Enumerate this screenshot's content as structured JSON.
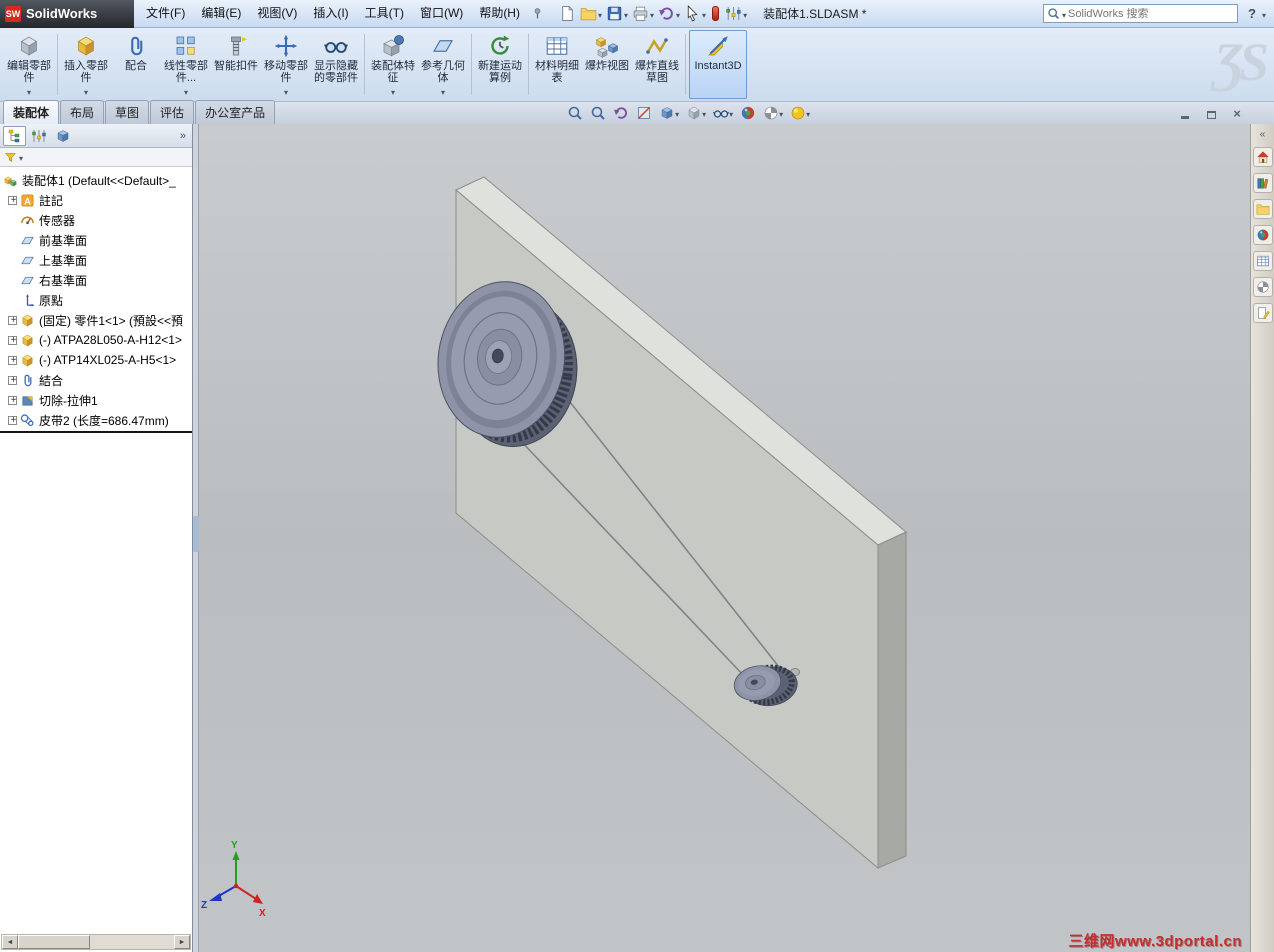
{
  "app": {
    "name": "SolidWorks",
    "logo_badge": "SW",
    "doc_title": "装配体1.SLDASM *",
    "ghost_logo": "ƷS"
  },
  "titlebar": {
    "help": "?"
  },
  "menubar": {
    "items": [
      "文件(F)",
      "编辑(E)",
      "视图(V)",
      "插入(I)",
      "工具(T)",
      "窗口(W)",
      "帮助(H)"
    ]
  },
  "search": {
    "placeholder": "SolidWorks 搜索"
  },
  "commandbar": {
    "buttons": [
      {
        "label": "编辑零部件",
        "dropdown": true
      },
      {
        "label": "插入零部件",
        "dropdown": true
      },
      {
        "label": "配合",
        "dropdown": false
      },
      {
        "label": "线性零部件...",
        "dropdown": true
      },
      {
        "label": "智能扣件",
        "dropdown": false
      },
      {
        "label": "移动零部件",
        "dropdown": true
      },
      {
        "label": "显示隐藏的零部件",
        "dropdown": false
      },
      {
        "label": "装配体特征",
        "dropdown": true
      },
      {
        "label": "参考几何体",
        "dropdown": true
      },
      {
        "label": "新建运动算例",
        "dropdown": false
      },
      {
        "label": "材料明细表",
        "dropdown": false
      },
      {
        "label": "爆炸视图",
        "dropdown": false
      },
      {
        "label": "爆炸直线草图",
        "dropdown": false
      },
      {
        "label": "Instant3D",
        "dropdown": false,
        "active": true
      }
    ]
  },
  "tabs": {
    "items": [
      {
        "label": "装配体",
        "active": true
      },
      {
        "label": "布局",
        "active": false
      },
      {
        "label": "草图",
        "active": false
      },
      {
        "label": "评估",
        "active": false
      },
      {
        "label": "办公室产品",
        "active": false
      }
    ]
  },
  "tree": {
    "root": "装配体1 (Default<<Default>_",
    "items": [
      {
        "label": "註記"
      },
      {
        "label": "传感器"
      },
      {
        "label": "前基準面"
      },
      {
        "label": "上基準面"
      },
      {
        "label": "右基準面"
      },
      {
        "label": "原點"
      },
      {
        "label": "(固定) 零件1<1> (預設<<預"
      },
      {
        "label": "(-) ATPA28L050-A-H12<1>"
      },
      {
        "label": "(-) ATP14XL025-A-H5<1>"
      },
      {
        "label": "結合"
      },
      {
        "label": "切除-拉伸1"
      },
      {
        "label": "皮带2 (长度=686.47mm)"
      }
    ]
  },
  "viewport": {
    "triad": {
      "x": "X",
      "y": "Y",
      "z": "Z"
    },
    "watermark": "三维网www.3dportal.cn"
  },
  "colors": {
    "accent_blue": "#2f6fbe",
    "selection": "#cfe3fb",
    "viewport_gray": "#bfc3c6",
    "watermark_red": "#c22f2f"
  },
  "icons": {
    "search": "magnifier",
    "new_document": "blank-page",
    "open": "folder",
    "save": "floppy-disk",
    "print": "printer",
    "undo": "curved-arrow",
    "select": "cursor-arrow",
    "options": "sliders",
    "view_orientation": "cube",
    "hide_show_items": "glasses",
    "edit_appearance": "color-sphere",
    "apply_scene": "checker-sphere",
    "taskpane_home": "house"
  }
}
